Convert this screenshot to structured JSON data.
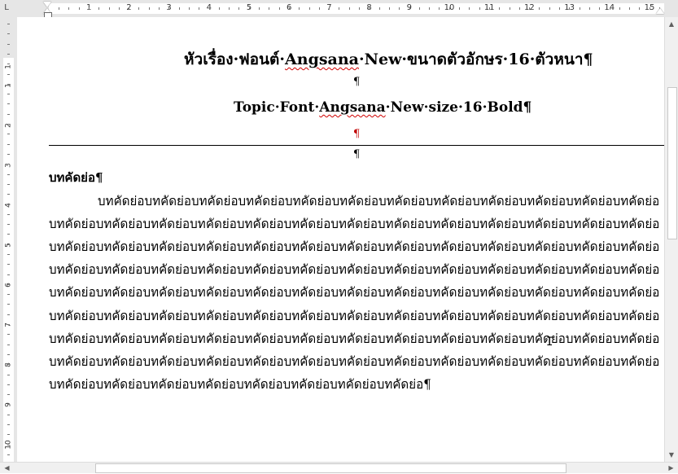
{
  "ruler": {
    "tab_selector": "L",
    "numbers": [
      "1",
      "2",
      "3",
      "4",
      "5",
      "6",
      "7",
      "8",
      "9",
      "10",
      "11",
      "12",
      "13",
      "14",
      "15"
    ],
    "vertical_numbers": [
      "1",
      "1",
      "2",
      "3",
      "4",
      "5",
      "6",
      "7",
      "8",
      "9",
      "10"
    ]
  },
  "document": {
    "title_th": {
      "before": "หัวเรื่อง·ฟอนต์·",
      "spell": "Angsana",
      "after": "·New·ขนาดตัวอักษร·16·ตัวหนา¶"
    },
    "blank1": "¶",
    "title_en": {
      "before": "Topic·Font·",
      "spell": "Angsana",
      "after": "·New·size·16·Bold¶"
    },
    "blank_red": "¶",
    "blank3": "¶",
    "heading": "บทคัดย่อ¶",
    "body_lines": [
      "บทคัดย่อบทคัดย่อบทคัดย่อบทคัดย่อบทคัดย่อบทคัดย่อบทคัดย่อบทคัดย่อบทคัดย่อบทคัดย่อบทคัดย่อบทคัดย่อ",
      "บทคัดย่อบทคัดย่อบทคัดย่อบทคัดย่อบทคัดย่อบทคัดย่อบทคัดย่อบทคัดย่อบทคัดย่อบทคัดย่อบทคัดย่อบทคัดย่อบทคัดย่อ",
      "บทคัดย่อบทคัดย่อบทคัดย่อบทคัดย่อบทคัดย่อบทคัดย่อบทคัดย่อบทคัดย่อบทคัดย่อบทคัดย่อบทคัดย่อบทคัดย่อบทคัดย่อ",
      "บทคัดย่อบทคัดย่อบทคัดย่อบทคัดย่อบทคัดย่อบทคัดย่อบทคัดย่อบทคัดย่อบทคัดย่อบทคัดย่อบทคัดย่อบทคัดย่อบทคัดย่อ",
      "บทคัดย่อบทคัดย่อบทคัดย่อบทคัดย่อบทคัดย่อบทคัดย่อบทคัดย่อบทคัดย่อบทคัดย่อบทคัดย่อบทคัดย่อบทคัดย่อบทคัดย่อ",
      "บทคัดย่อบทคัดย่อบทคัดย่อบทคัดย่อบทคัดย่อบทคัดย่อบทคัดย่อบทคัดย่อบทคัดย่อบทคัดย่อบทคัดย่อบทคัดย่อบทคัดย่อ",
      "บทคัดย่อบทคัดย่อบทคัดย่อบทคัดย่อบทคัดย่อบทคัดย่อบทคัดย่อบทคัดย่อบทคัดย่อบทคัดย่อบทคัดย่อบทคัดย่อบทคัดย่อ",
      "บทคัดย่อบทคัดย่อบทคัดย่อบทคัดย่อบทคัดย่อบทคัดย่อบทคัดย่อบทคัดย่อบทคัดย่อบทคัดย่อบทคัดย่อบทคัดย่อบทคัดย่อ",
      "บทคัดย่อบทคัดย่อบทคัดย่อบทคัดย่อบทคัดย่อบทคัดย่อบทคัดย่อบทคัดย่อ¶"
    ]
  },
  "scrollbar": {
    "up": "▲",
    "down": "▼",
    "left": "◀",
    "right": "▶"
  },
  "colors": {
    "spell_error": "#d00000",
    "paragraph_mark_red": "#c00000"
  }
}
